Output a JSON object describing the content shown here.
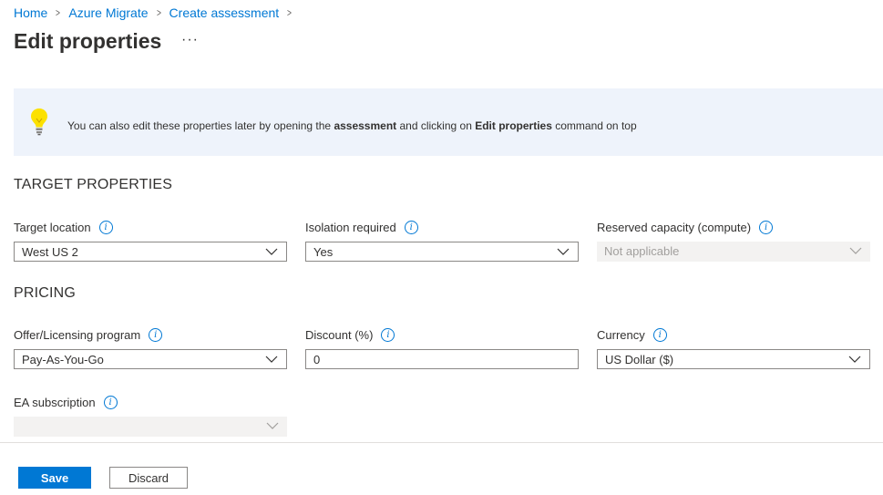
{
  "breadcrumb": {
    "items": [
      "Home",
      "Azure Migrate",
      "Create assessment"
    ],
    "separator": ">"
  },
  "page": {
    "title": "Edit properties",
    "more": "···"
  },
  "banner": {
    "text_1": "You can also edit these properties later by opening the ",
    "bold_1": "assessment",
    "text_2": " and clicking on ",
    "bold_2": "Edit properties",
    "text_3": " command on top",
    "icon": "lightbulb-icon"
  },
  "target_properties": {
    "heading": "TARGET PROPERTIES",
    "target_location": {
      "label": "Target location",
      "value": "West US 2"
    },
    "isolation_required": {
      "label": "Isolation required",
      "value": "Yes"
    },
    "reserved_capacity": {
      "label": "Reserved capacity (compute)",
      "value": "Not applicable"
    }
  },
  "pricing": {
    "heading": "PRICING",
    "offer": {
      "label": "Offer/Licensing program",
      "value": "Pay-As-You-Go"
    },
    "discount": {
      "label": "Discount (%)",
      "value": "0"
    },
    "currency": {
      "label": "Currency",
      "value": "US Dollar ($)"
    },
    "ea_subscription": {
      "label": "EA subscription",
      "value": ""
    }
  },
  "footer": {
    "save": "Save",
    "discard": "Discard"
  },
  "colors": {
    "accent": "#0078d4",
    "banner_bg": "#eef3fb",
    "disabled_bg": "#f3f2f1"
  }
}
